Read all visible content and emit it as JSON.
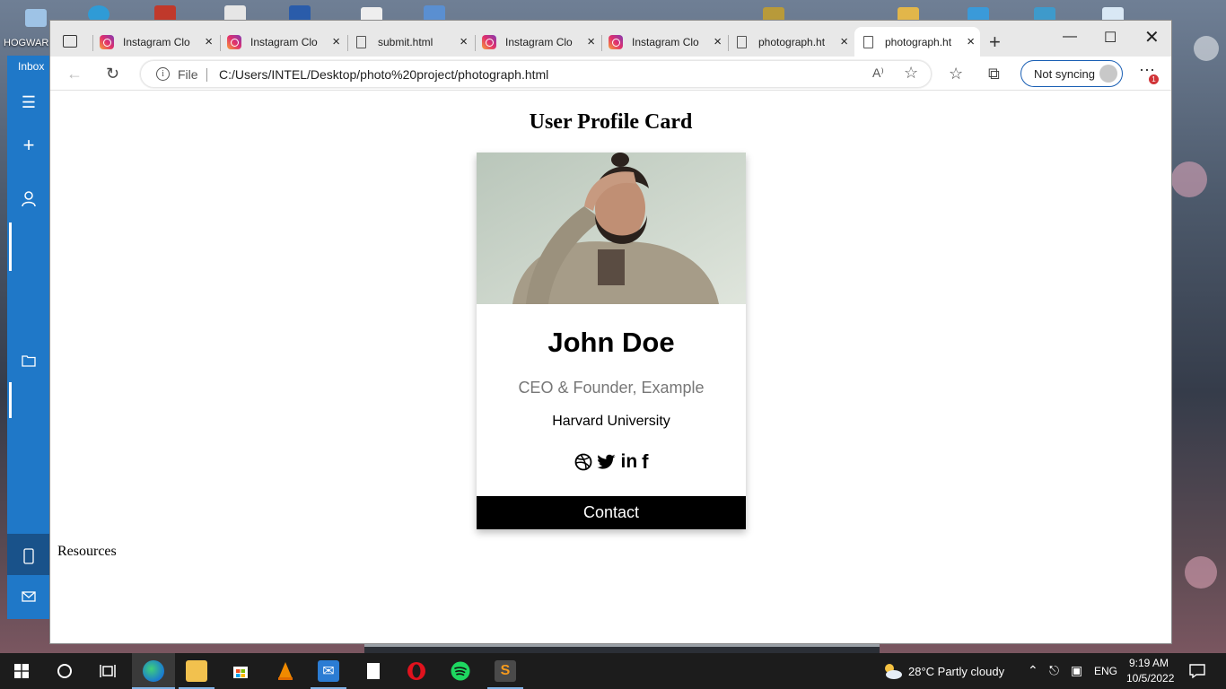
{
  "desktop": {
    "icon_label": "HOGWAR"
  },
  "mail_app": {
    "inbox_label": "Inbox"
  },
  "browser": {
    "tabs": [
      {
        "title": "Instagram Clo",
        "icon": "instagram-icon"
      },
      {
        "title": "Instagram Clo",
        "icon": "instagram-icon"
      },
      {
        "title": "submit.html",
        "icon": "file-icon"
      },
      {
        "title": "Instagram Clo",
        "icon": "instagram-icon"
      },
      {
        "title": "Instagram Clo",
        "icon": "instagram-icon"
      },
      {
        "title": "photograph.ht",
        "icon": "file-icon"
      },
      {
        "title": "photograph.ht",
        "icon": "file-icon",
        "active": true
      }
    ],
    "address": {
      "scheme_label": "File",
      "url": "C:/Users/INTEL/Desktop/photo%20project/photograph.html",
      "read_aloud": "A⁾"
    },
    "sync_label": "Not syncing",
    "notification_count": "1"
  },
  "page": {
    "title": "User Profile Card",
    "card": {
      "name": "John Doe",
      "role": "CEO & Founder, Example",
      "school": "Harvard University",
      "socials": [
        "dribbble-icon",
        "twitter-icon",
        "linkedin-icon",
        "facebook-icon"
      ],
      "linkedin_text": "in",
      "facebook_text": "f",
      "contact_label": "Contact"
    },
    "resources_label": "Resources"
  },
  "taskbar": {
    "weather": "28°C  Partly cloudy",
    "language": "ENG",
    "time": "9:19 AM",
    "date": "10/5/2022"
  },
  "colors": {
    "contact_bg": "#000000",
    "mail_blue": "#1f78c8",
    "sync_border": "#1a5fb4"
  }
}
